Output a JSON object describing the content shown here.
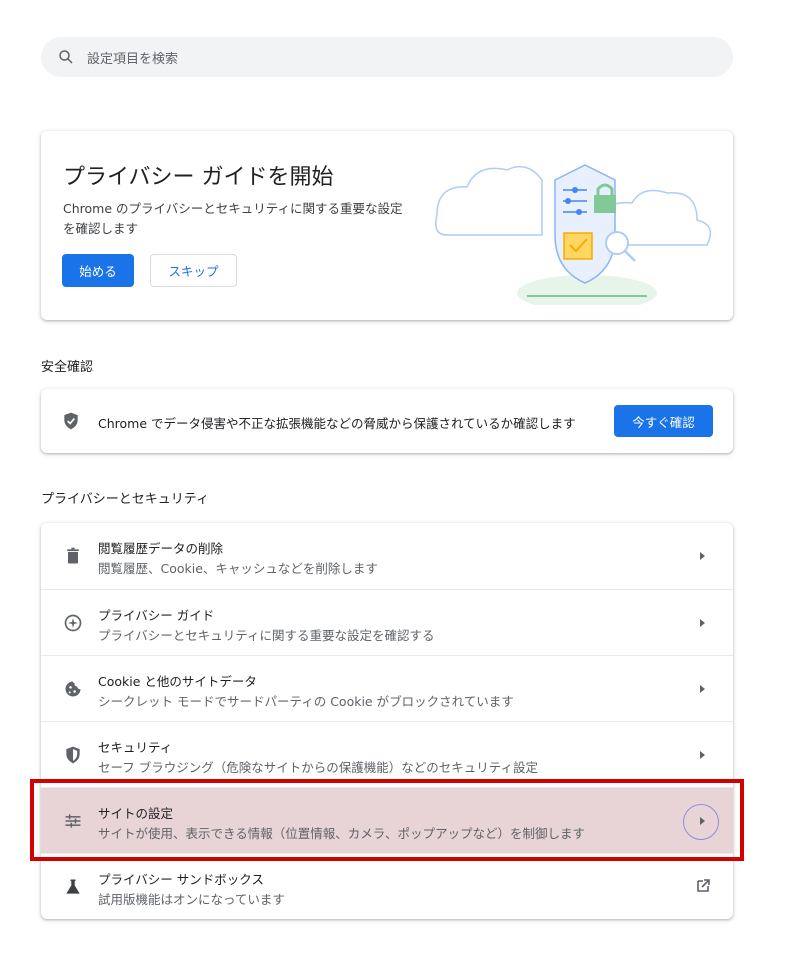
{
  "search": {
    "placeholder": "設定項目を検索",
    "icon": "search-icon"
  },
  "guide_card": {
    "title": "プライバシー ガイドを開始",
    "description": "Chrome のプライバシーとセキュリティに関する重要な設定を確認します",
    "start_label": "始める",
    "skip_label": "スキップ"
  },
  "safety": {
    "heading": "安全確認",
    "text": "Chrome でデータ侵害や不正な拡張機能などの脅威から保護されているか確認します",
    "button_label": "今すぐ確認"
  },
  "privacy": {
    "heading": "プライバシーとセキュリティ",
    "items": [
      {
        "title": "閲覧履歴データの削除",
        "subtitle": "閲覧履歴、Cookie、キャッシュなどを削除します",
        "icon": "trash-icon"
      },
      {
        "title": "プライバシー ガイド",
        "subtitle": "プライバシーとセキュリティに関する重要な設定を確認する",
        "icon": "compass-icon"
      },
      {
        "title": "Cookie と他のサイトデータ",
        "subtitle": "シークレット モードでサードパーティの Cookie がブロックされています",
        "icon": "cookie-icon"
      },
      {
        "title": "セキュリティ",
        "subtitle": "セーフ ブラウジング（危険なサイトからの保護機能）などのセキュリティ設定",
        "icon": "shield-icon"
      },
      {
        "title": "サイトの設定",
        "subtitle": "サイトが使用、表示できる情報（位置情報、カメラ、ポップアップなど）を制御します",
        "icon": "tune-icon"
      },
      {
        "title": "プライバシー サンドボックス",
        "subtitle": "試用版機能はオンになっています",
        "icon": "flask-icon"
      }
    ]
  },
  "colors": {
    "accent": "#1a73e8",
    "highlight": "#e8d3d7",
    "annotation": "#d40000"
  }
}
